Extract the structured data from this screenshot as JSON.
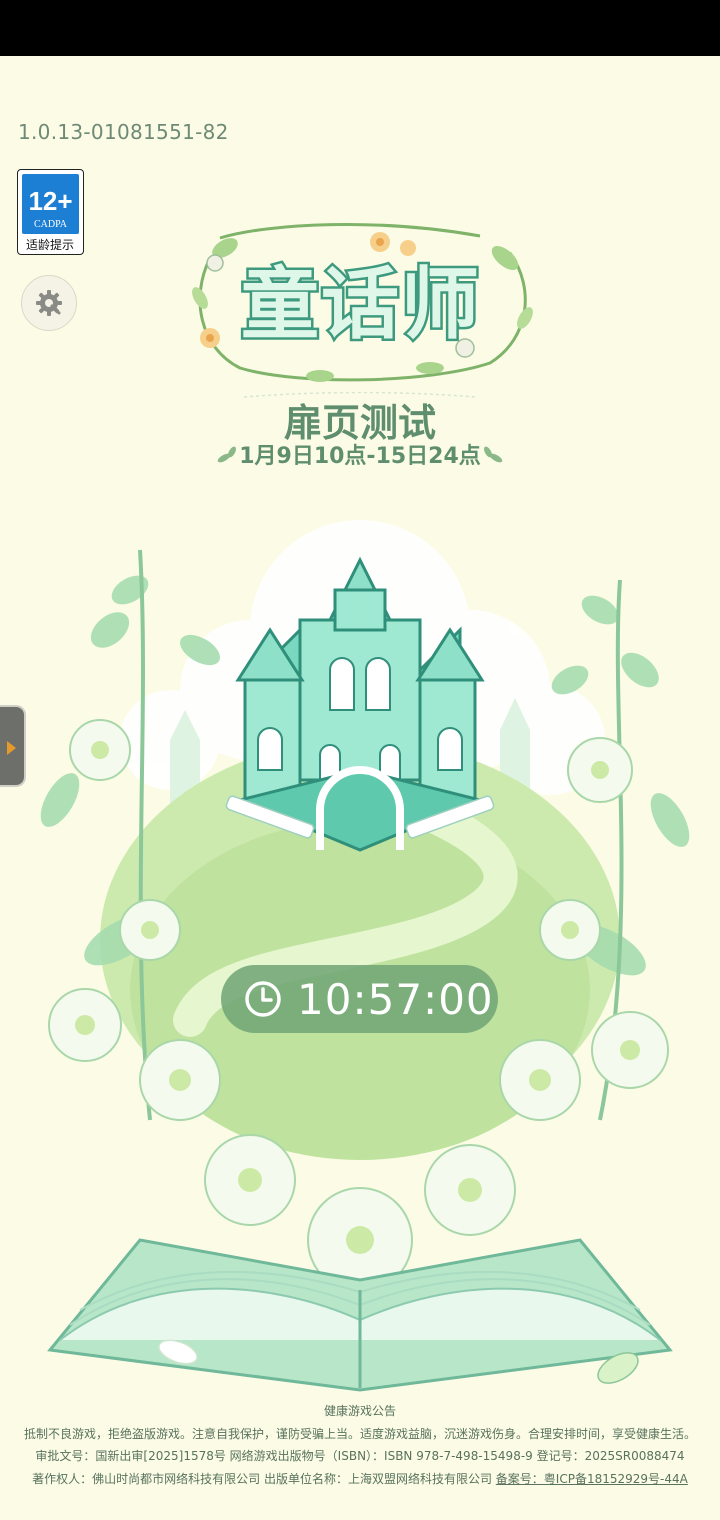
{
  "app": {
    "version": "1.0.13-01081551-82",
    "logo_title": "童话师"
  },
  "age_rating": {
    "age": "12+",
    "org": "CADPA",
    "label": "适龄提示"
  },
  "event": {
    "title": "扉页测试",
    "dates": "1月9日10点-15日24点"
  },
  "timer": {
    "time": "10:57:00"
  },
  "footer": {
    "notice_title": "健康游戏公告",
    "notice_text": "抵制不良游戏，拒绝盗版游戏。注意自我保护，谨防受骗上当。适度游戏益脑，沉迷游戏伤身。合理安排时间，享受健康生活。",
    "approval": "审批文号：国新出审[2025]1578号  网络游戏出版物号（ISBN）：ISBN 978-7-498-15498-9  登记号：2025SR0088474",
    "copyright": "著作权人：佛山时尚都市网络科技有限公司  出版单位名称：上海双盟网络科技有限公司",
    "icp": "备案号：粤ICP备18152929号-44A"
  },
  "colors": {
    "background": "#fcfce6",
    "accent_green": "#5f8e6e",
    "timer_pill": "#6fa574",
    "age_blue": "#1d7fd4"
  },
  "icons": [
    "settings-gear-icon",
    "clock-icon",
    "side-arrow-icon"
  ]
}
